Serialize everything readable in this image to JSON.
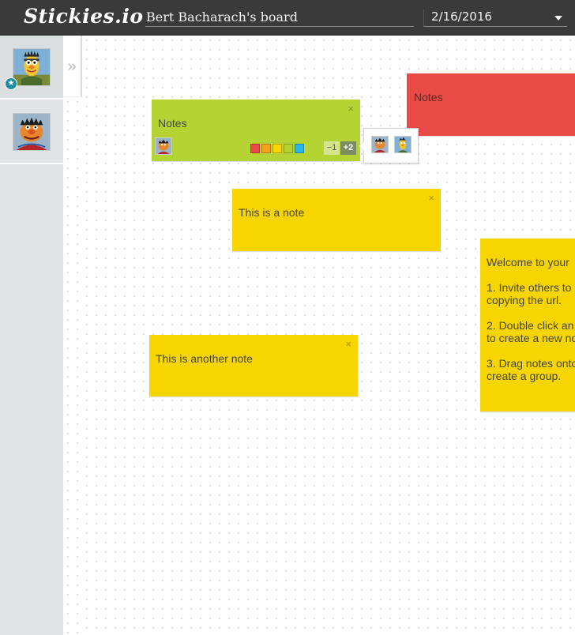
{
  "app": {
    "logo": "Stickies.io"
  },
  "header": {
    "board_title": "Bert Bacharach's board",
    "date": "2/16/2016"
  },
  "sidebar": {
    "users": [
      {
        "name": "Bert",
        "starred": true
      },
      {
        "name": "Ernie",
        "starred": false
      }
    ],
    "collapse_glyph": "»"
  },
  "notes": [
    {
      "id": "red",
      "text": "Notes",
      "color": "#e84a45"
    },
    {
      "id": "green",
      "text": "Notes",
      "color": "#b5d333",
      "swatches": [
        "#e84a45",
        "#f5a11b",
        "#f7d500",
        "#b5d333",
        "#29b6e8"
      ],
      "votes": {
        "minus": "−1",
        "plus": "+2"
      }
    },
    {
      "id": "yellow1",
      "text": "This is a note",
      "color": "#f7d500"
    },
    {
      "id": "yellow2",
      "text": "This is another note",
      "color": "#f7d500"
    },
    {
      "id": "welcome",
      "color": "#f7d500",
      "text": "Welcome to your \n\n1. Invite others to \ncopying the url.\n\n2. Double click an\nto create a new no\n\n3. Drag notes onto\ncreate a group."
    }
  ],
  "close_glyph": "×",
  "icons": {
    "star": "★",
    "caret": "chevron-down-icon"
  }
}
